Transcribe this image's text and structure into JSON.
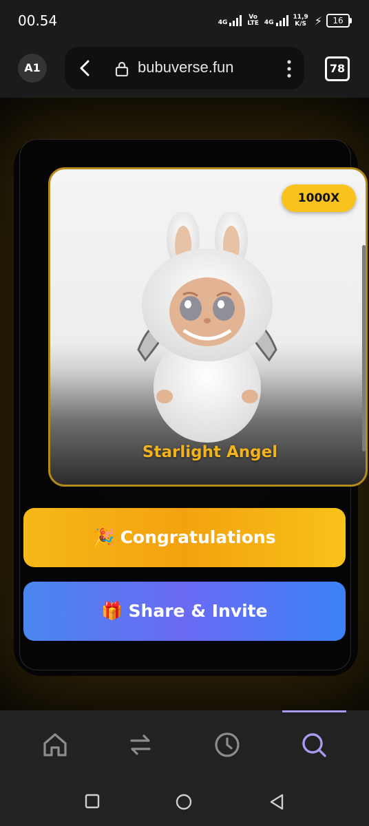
{
  "status_bar": {
    "time": "00.54",
    "sim1_label": "4G",
    "volte_top": "Vo",
    "volte_bottom": "LTE",
    "sim2_label": "4G",
    "speed_value": "11,9",
    "speed_unit": "K/S",
    "battery": "16"
  },
  "browser": {
    "profile": "A1",
    "url": "bubuverse.fun",
    "tab_count": "78",
    "icons": [
      "back-arrow-icon",
      "lock-icon",
      "kebab-menu-icon"
    ]
  },
  "prize_card": {
    "multiplier": "1000X",
    "name": "Starlight Angel",
    "accent_color": "#f2b31c",
    "border_color": "#b48a1c"
  },
  "buttons": {
    "congrats_emoji": "🎉",
    "congrats_label": "Congratulations",
    "share_emoji": "🎁",
    "share_label": "Share & Invite"
  },
  "app_nav": {
    "items": [
      "home-icon",
      "swap-icon",
      "history-icon",
      "search-icon"
    ],
    "active": "search-icon",
    "active_color": "#a99af0"
  },
  "system_nav": [
    "recents-square-icon",
    "home-circle-icon",
    "back-triangle-icon"
  ]
}
